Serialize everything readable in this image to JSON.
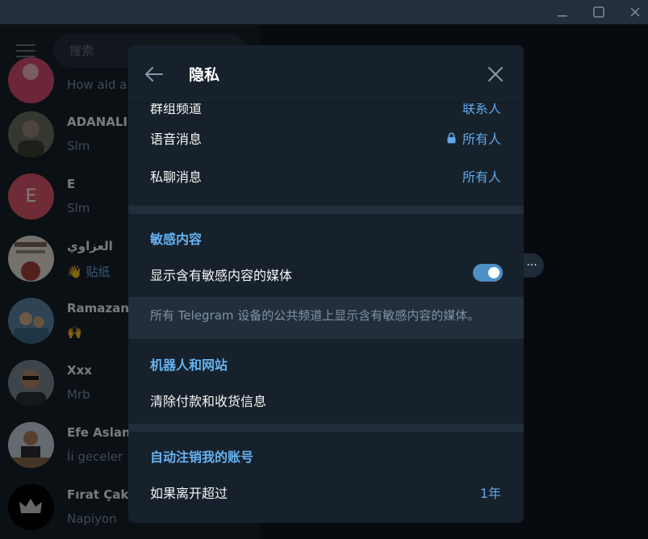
{
  "window": {
    "minimize_icon": "minimize-icon",
    "maximize_icon": "maximize-icon",
    "close_icon": "close-icon"
  },
  "sidebar": {
    "search_placeholder": "搜索",
    "chats": [
      {
        "name": "",
        "preview": "How ald a"
      },
      {
        "name": "ADANALIC",
        "preview": "Slm"
      },
      {
        "name": "E",
        "preview": "Slm",
        "avatar_letter": "E"
      },
      {
        "name": "العزاوي",
        "preview": "👋 贴纸"
      },
      {
        "name": "Ramazan",
        "preview": "🙌"
      },
      {
        "name": "Xxx",
        "preview": "Mrb"
      },
      {
        "name": "Efe Aslan",
        "preview": "İi geceler"
      },
      {
        "name": "Fırat Çakır",
        "preview": "Napiyon"
      }
    ]
  },
  "right_pane": {
    "more_label": "···"
  },
  "dialog": {
    "title": "隐私",
    "rows_top": [
      {
        "label": "群组频道",
        "value": "联系人"
      },
      {
        "label": "语音消息",
        "value": "所有人",
        "locked": true
      },
      {
        "label": "私聊消息",
        "value": "所有人"
      }
    ],
    "sensitive": {
      "title": "敏感内容",
      "toggle_label": "显示含有敏感内容的媒体",
      "toggle_on": true,
      "note": "所有 Telegram 设备的公共频道上显示含有敏感内容的媒体。"
    },
    "bots": {
      "title": "机器人和网站",
      "row_label": "清除付款和收货信息"
    },
    "autodelete": {
      "title": "自动注销我的账号",
      "row_label": "如果离开超过",
      "row_value": "1年"
    }
  },
  "colors": {
    "accent": "#5fa8e8",
    "section_title": "#64b2f2",
    "toggle": "#4d8fc7",
    "dialog_bg": "#17212b",
    "divider": "#232e3c"
  }
}
